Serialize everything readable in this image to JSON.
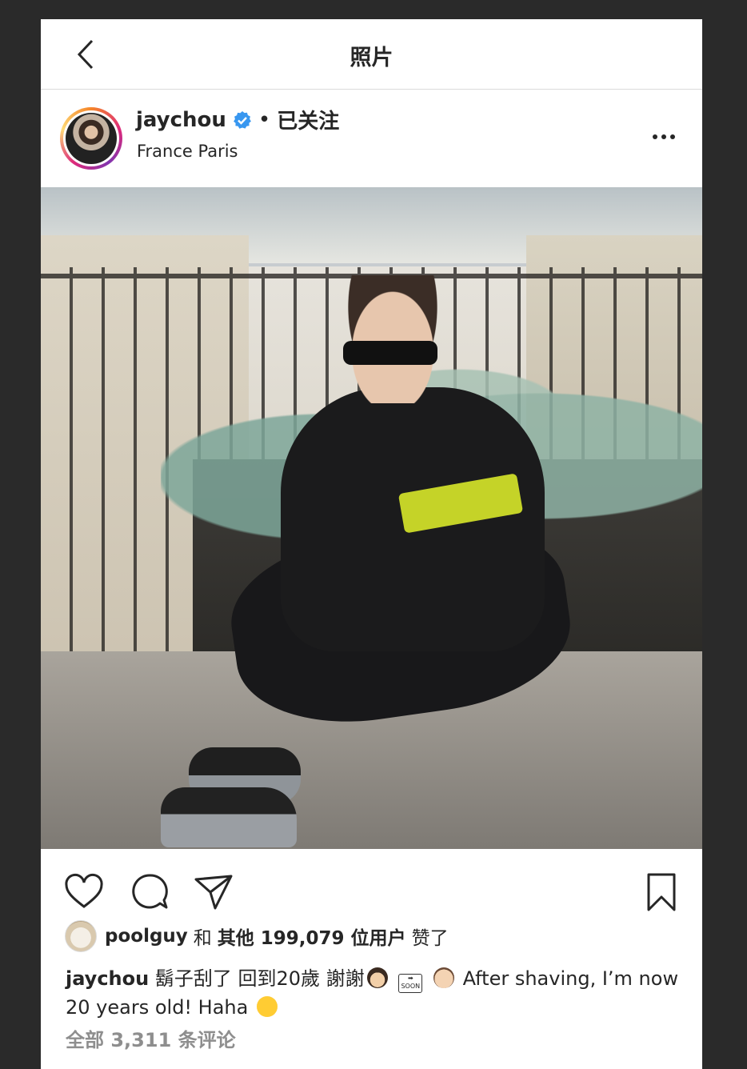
{
  "header": {
    "title": "照片"
  },
  "post": {
    "username": "jaychou",
    "follow_state": "已关注",
    "separator": "•",
    "location": "France Paris"
  },
  "likes": {
    "liker": "poolguy",
    "connector": "和",
    "others": "其他 199,079 位用户",
    "suffix": "赞了"
  },
  "caption": {
    "username": "jaychou",
    "text_cn": "鬍子刮了 回到20歲 謝謝",
    "text_en": "After shaving, I’m now 20 years old! Haha",
    "soon_label": "SOON"
  },
  "comments": {
    "label": "全部 3,311 条评论"
  },
  "colors": {
    "verified": "#3897f0",
    "muted_text": "#8e8e8e",
    "text": "#262626"
  }
}
